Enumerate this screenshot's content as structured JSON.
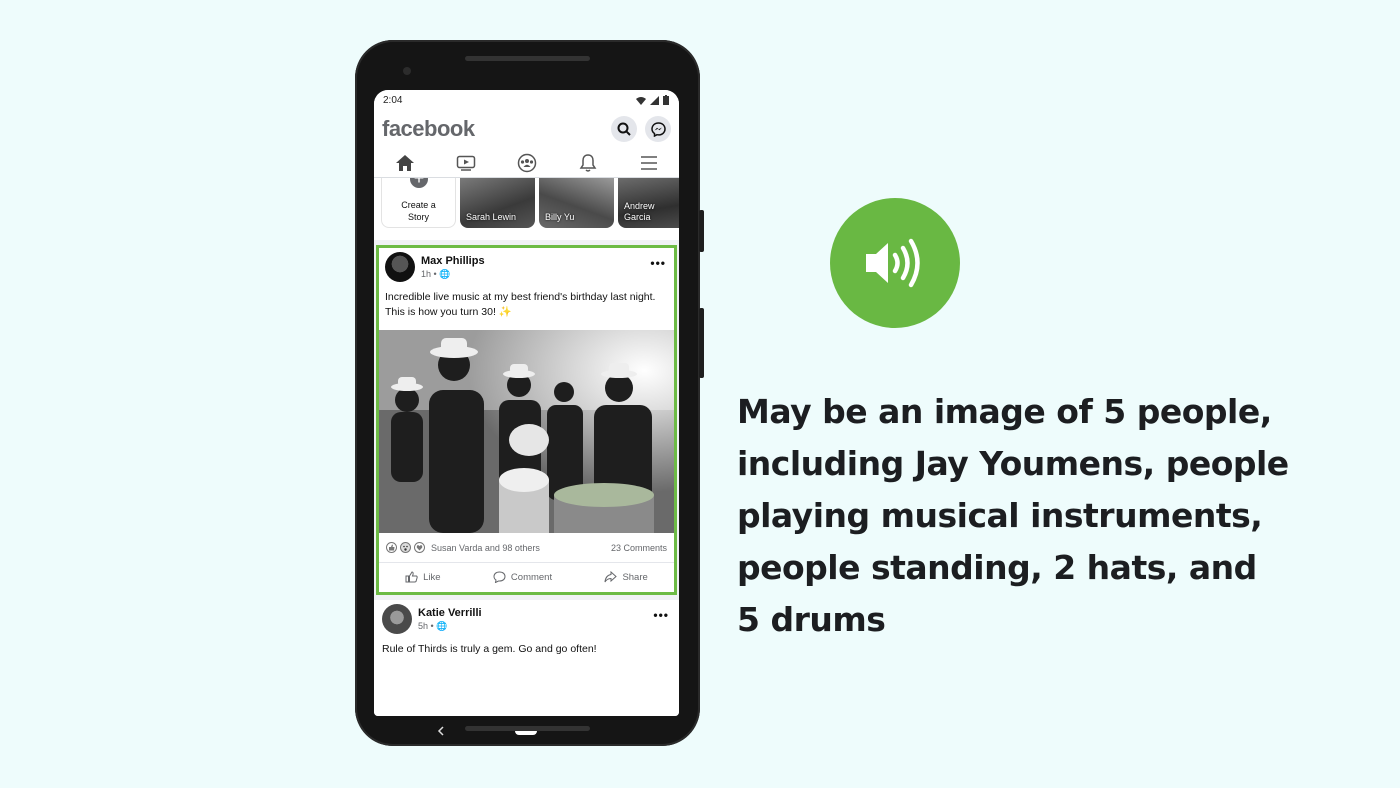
{
  "status_bar": {
    "time": "2:04"
  },
  "header": {
    "logo": "facebook"
  },
  "stories": [
    {
      "label": "Create a Story"
    },
    {
      "label": "Sarah Lewin"
    },
    {
      "label": "Billy Yu"
    },
    {
      "label": "Andrew Garcia"
    }
  ],
  "post": {
    "author": "Max Phillips",
    "time": "1h",
    "text": "Incredible live music at my best friend's birthday last night. This is how you turn 30! ✨",
    "reactions_text": "Susan Varda and 98 others",
    "comments_text": "23 Comments",
    "like_label": "Like",
    "comment_label": "Comment",
    "share_label": "Share"
  },
  "post2": {
    "author": "Katie Verrilli",
    "time": "5h",
    "text": "Rule of Thirds is truly a gem. Go and go often!"
  },
  "alt_text": {
    "line1": "May be an image of 5 people,",
    "line2": "including Jay Youmens, people",
    "line3": "playing musical instruments,",
    "line4": "people standing, 2 hats, and",
    "line5": "5 drums"
  },
  "colors": {
    "accent_green": "#69b843",
    "highlight_border": "#6dbb45",
    "background": "#eefcfc"
  }
}
